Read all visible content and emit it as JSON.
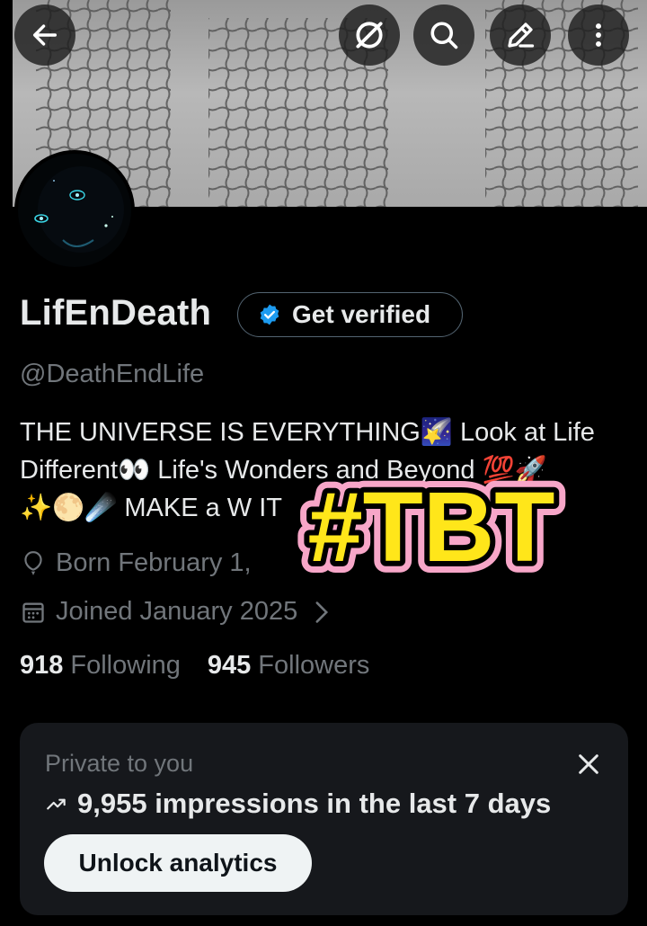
{
  "profile": {
    "name": "LifEnDeath",
    "handle": "@DeathEndLife",
    "verify_label": "Get verified",
    "bio_lines": [
      "THE UNIVERSE IS EVERYTHING🌠 Look at Life",
      "Different👀 Life's Wonders and Beyond 💯🚀",
      "✨🌕☄️  MAKE a W                                          IT"
    ],
    "born": "Born February 1,",
    "joined": "Joined January 2025",
    "following_count": "918",
    "following_label": "Following",
    "followers_count": "945",
    "followers_label": "Followers"
  },
  "top_icons": [
    "back-arrow-icon",
    "no-sign-icon",
    "search-icon",
    "edit-icon",
    "more-vertical-icon"
  ],
  "analytics_card": {
    "private_label": "Private to you",
    "impressions_text": "9,955 impressions in the last 7 days",
    "unlock_label": "Unlock analytics"
  },
  "sticker": {
    "text": "#TBT",
    "fill_color": "#ffe61a",
    "outline_color": "#f7a6c8"
  },
  "colors": {
    "background": "#000000",
    "verified_badge": "#1d9bf0",
    "muted_text": "#71767b",
    "card_bg": "#16181c"
  }
}
